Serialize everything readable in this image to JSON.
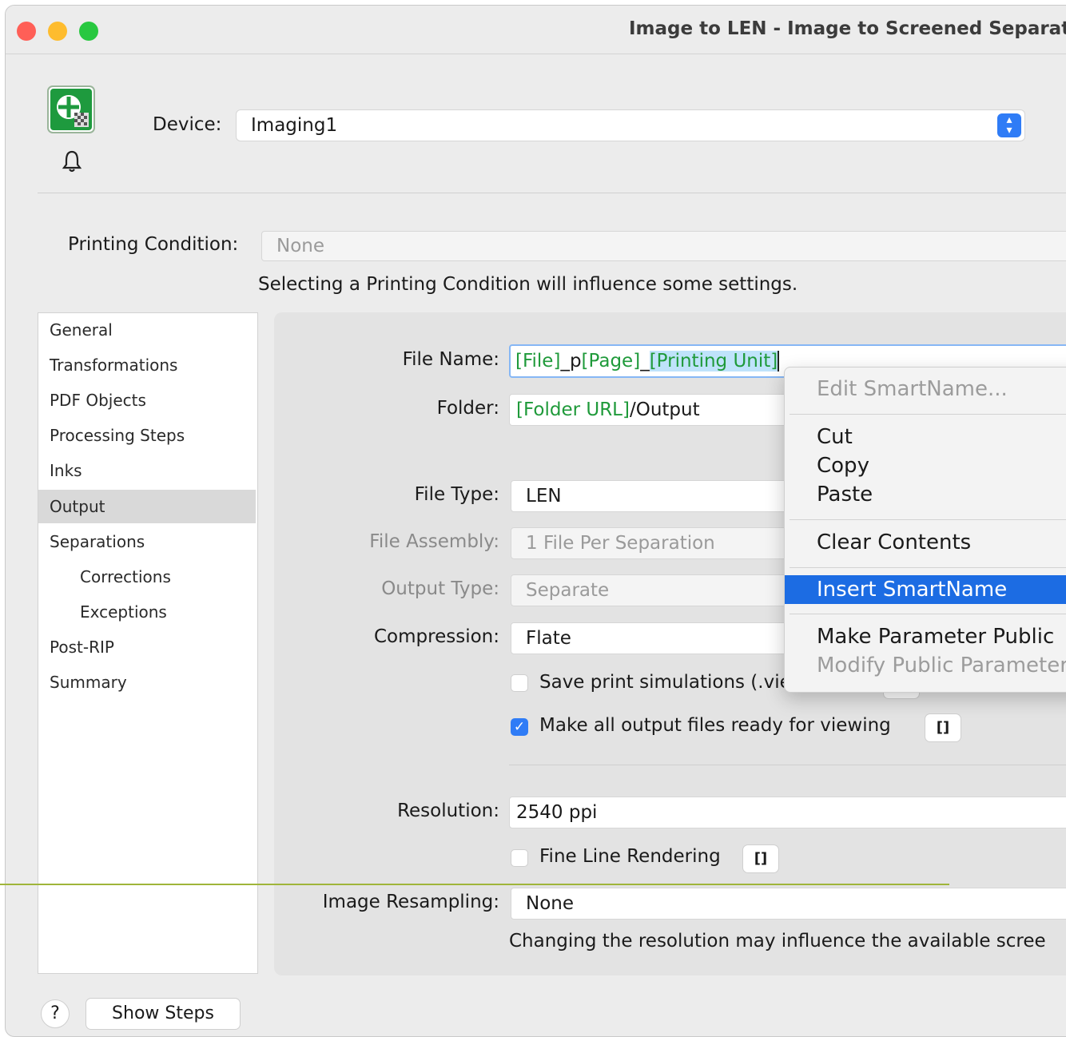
{
  "window": {
    "title": "Image to LEN - Image to Screened Separation"
  },
  "traffic_lights": {
    "close": "#ff5f57",
    "minimize": "#febc2e",
    "maximize": "#28c840"
  },
  "device": {
    "label": "Device:",
    "value": "Imaging1"
  },
  "printing_condition": {
    "label": "Printing Condition:",
    "value": "None",
    "note": "Selecting a Printing Condition will influence some settings."
  },
  "sidebar": {
    "items": [
      {
        "label": "General"
      },
      {
        "label": "Transformations"
      },
      {
        "label": "PDF Objects"
      },
      {
        "label": "Processing Steps"
      },
      {
        "label": "Inks"
      },
      {
        "label": "Output",
        "selected": true
      },
      {
        "label": "Separations"
      },
      {
        "label": "Corrections"
      },
      {
        "label": "Exceptions"
      },
      {
        "label": "Post-RIP"
      },
      {
        "label": "Summary"
      }
    ]
  },
  "output": {
    "file_name": {
      "label": "File Name:",
      "parts": [
        "[File]",
        "_p",
        "[Page]",
        "_",
        "[Printing Unit]"
      ]
    },
    "folder": {
      "label": "Folder:",
      "parts": [
        "[Folder URL]",
        "/Output"
      ]
    },
    "file_type": {
      "label": "File Type:",
      "value": "LEN"
    },
    "file_assembly": {
      "label": "File Assembly:",
      "value": "1 File Per Separation"
    },
    "output_type": {
      "label": "Output Type:",
      "value": "Separate"
    },
    "compression": {
      "label": "Compression:",
      "value": "Flate"
    },
    "save_print_simulations": {
      "label": "Save print simulations (.view files)",
      "checked": false
    },
    "make_ready_for_viewing": {
      "label": "Make all output files ready for viewing",
      "checked": true
    },
    "resolution": {
      "label": "Resolution:",
      "value": "2540 ppi"
    },
    "fine_line_rendering": {
      "label": "Fine Line Rendering",
      "checked": false
    },
    "image_resampling": {
      "label": "Image Resampling:",
      "value": "None"
    },
    "resolution_note": "Changing the resolution may influence the available scree",
    "bracket_label": "[]"
  },
  "context_menu": {
    "items": [
      {
        "label": "Edit SmartName...",
        "disabled": true
      },
      {
        "label": "Cut"
      },
      {
        "label": "Copy"
      },
      {
        "label": "Paste"
      },
      {
        "label": "Clear Contents"
      },
      {
        "label": "Insert SmartName",
        "highlighted": true
      },
      {
        "label": "Make Parameter Public"
      },
      {
        "label": "Modify Public Parameter",
        "disabled": true
      }
    ]
  },
  "footer": {
    "help_label": "?",
    "show_steps_label": "Show Steps"
  },
  "colors": {
    "accent": "#2f7cf6",
    "menu_highlight": "#1c6ce3",
    "smartname_green": "#1f9a3a",
    "text_selection": "#bfe3fb"
  }
}
